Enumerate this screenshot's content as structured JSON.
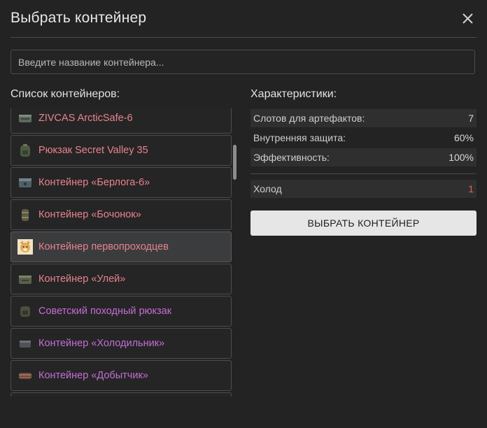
{
  "dialog": {
    "title": "Выбрать контейнер",
    "close_icon": "close-icon"
  },
  "search": {
    "placeholder": "Введите название контейнера...",
    "value": ""
  },
  "list": {
    "title": "Список контейнеров:",
    "items": [
      {
        "label": "ZIVCAS ArcticSafe-6",
        "icon": "container-icon",
        "color": "#e8838f"
      },
      {
        "label": "Рюкзак Secret Valley 35",
        "icon": "backpack-icon",
        "color": "#e8838f"
      },
      {
        "label": "Контейнер «Берлога-6»",
        "icon": "container-icon",
        "color": "#e8838f"
      },
      {
        "label": "Контейнер «Бочонок»",
        "icon": "barrel-icon",
        "color": "#e8838f"
      },
      {
        "label": "Контейнер первопроходцев",
        "icon": "dog-avatar-icon",
        "color": "#e8838f",
        "selected": true
      },
      {
        "label": "Контейнер «Улей»",
        "icon": "container-icon",
        "color": "#e8838f"
      },
      {
        "label": "Советский походный рюкзак",
        "icon": "backpack-icon",
        "color": "#c46fd6"
      },
      {
        "label": "Контейнер «Холодильник»",
        "icon": "container-icon",
        "color": "#c46fd6"
      },
      {
        "label": "Контейнер «Добытчик»",
        "icon": "container-icon",
        "color": "#c46fd6"
      }
    ]
  },
  "stats": {
    "title": "Характеристики:",
    "rows": [
      {
        "label": "Слотов для артефактов:",
        "value": "7"
      },
      {
        "label": "Внутренняя защита:",
        "value": "60%"
      },
      {
        "label": "Эффективность:",
        "value": "100%"
      }
    ],
    "extra": [
      {
        "label": "Холод",
        "value": "1",
        "value_color": "#d96363"
      }
    ]
  },
  "action": {
    "select_label": "ВЫБРАТЬ КОНТЕЙНЕР"
  }
}
